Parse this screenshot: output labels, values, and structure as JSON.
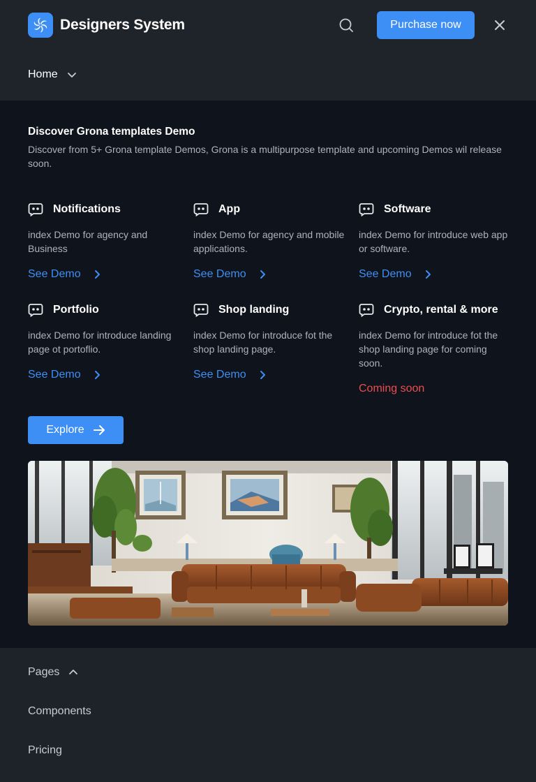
{
  "header": {
    "brand_name": "Designers System",
    "purchase_label": "Purchase now",
    "home_label": "Home"
  },
  "panel": {
    "title": "Discover Grona templates Demo",
    "description": "Discover from 5+ Grona template Demos, Grona is a multipurpose template and upcoming Demos wil release\nsoon.",
    "items": [
      {
        "title": "Notifications",
        "description": "index Demo for agency and Business",
        "link": "See Demo"
      },
      {
        "title": "App",
        "description": "index Demo for agency and mobile applications.",
        "link": "See Demo"
      },
      {
        "title": "Software",
        "description": "index Demo for introduce web app or software.",
        "link": "See Demo"
      },
      {
        "title": "Portfolio",
        "description": "index Demo for introduce landing page ot portoflio.",
        "link": "See Demo"
      },
      {
        "title": "Shop landing",
        "description": "index Demo for introduce fot the shop landing page.",
        "link": "See Demo"
      },
      {
        "title": "Crypto, rental & more",
        "description": "index Demo for introduce fot the shop landing page for coming soon.",
        "status": "Coming soon"
      }
    ],
    "explore_label": "Explore"
  },
  "bottom_nav": {
    "pages": "Pages",
    "components": "Components",
    "pricing": "Pricing"
  },
  "colors": {
    "accent": "#3d8ff5",
    "coming_soon": "#ee4d4d",
    "panel_bg": "#0e131c",
    "header_bg": "#1f242b"
  },
  "icons": {
    "logo": "swirl-logo-icon",
    "search": "search-icon",
    "close": "close-icon",
    "item": "chat-bubble-icon",
    "link_arrow": "chevron-right-icon",
    "explore_arrow": "arrow-right-icon"
  }
}
